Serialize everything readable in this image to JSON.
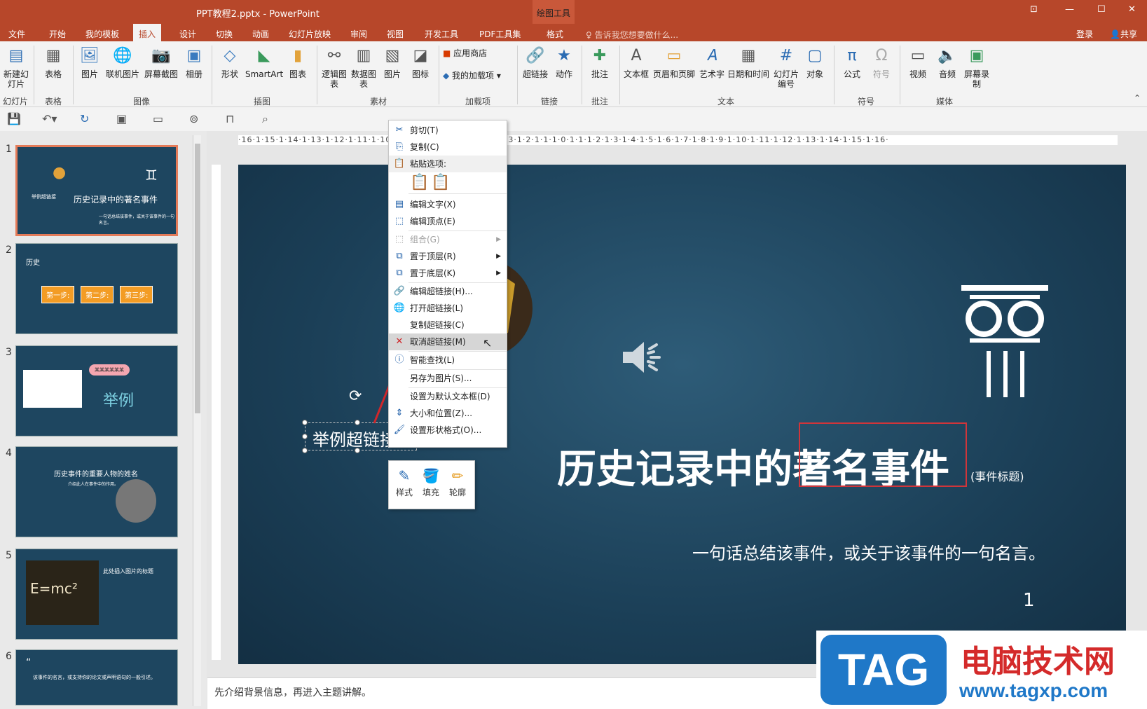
{
  "window": {
    "title": "PPT教程2.pptx - PowerPoint",
    "context_tab_group": "绘图工具"
  },
  "tabs": [
    "文件",
    "开始",
    "我的模板",
    "插入",
    "设计",
    "切换",
    "动画",
    "幻灯片放映",
    "审阅",
    "视图",
    "开发工具",
    "PDF工具集",
    "格式"
  ],
  "active_tab": "插入",
  "tell_me": "告诉我您想要做什么...",
  "account": {
    "login": "登录",
    "share": "共享"
  },
  "ribbon": {
    "buttons": [
      "新建幻灯片",
      "表格",
      "图片",
      "联机图片",
      "屏幕截图",
      "相册",
      "形状",
      "SmartArt",
      "图表",
      "逻辑图表",
      "数据图表",
      "图片",
      "图标",
      "应用商店",
      "我的加载项",
      "超链接",
      "动作",
      "批注",
      "文本框",
      "页眉和页脚",
      "艺术字",
      "日期和时间",
      "幻灯片编号",
      "对象",
      "公式",
      "符号",
      "视频",
      "音频",
      "屏幕录制"
    ],
    "groups": [
      "幻灯片",
      "表格",
      "图像",
      "插图",
      "素材",
      "加载项",
      "链接",
      "批注",
      "文本",
      "符号",
      "媒体"
    ]
  },
  "thumbnails": [
    {
      "num": "1",
      "title": "历史记录中的著名事件",
      "small": "举例超链接",
      "foot": "一句话总结该事件，或关于该事件的一句名言。"
    },
    {
      "num": "2",
      "title": "历史",
      "steps": [
        "第一步:",
        "第二步:",
        "第三步:"
      ]
    },
    {
      "num": "3",
      "title": "举例",
      "bubble": "某某某某某某"
    },
    {
      "num": "4",
      "title": "历史事件的重要人物的姓名",
      "sub": "介绍此人在事件中的作用。"
    },
    {
      "num": "5",
      "title": "此处插入图片的标题",
      "formula": "E=mc²"
    },
    {
      "num": "6",
      "title": "该事件的名言，或支持你的论文或声明语句的一般引述。"
    }
  ],
  "ruler": {
    "h_ticks": "·16·1·15·1·14·1·13·1·12·1·11·1·10·1·9·1·8·1·7·1·6·1·5·1·4·1·3·1·2·1·1·1·0·1·1·1·2·1·3·1·4·1·5·1·6·1·7·1·8·1·9·1·10·1·11·1·12·1·13·1·14·1·15·1·16·"
  },
  "slide": {
    "title": "历史记录中的著名事件",
    "title_hint": "(事件标题)",
    "quote": "一句话总结该事件，或关于该事件的一句名言。",
    "page_number": "1",
    "textbox": "举例超链接"
  },
  "context_menu": {
    "items": [
      {
        "label": "剪切(T)",
        "icon": "cut-icon"
      },
      {
        "label": "复制(C)",
        "icon": "copy-icon"
      },
      {
        "label": "粘贴选项:",
        "icon": "paste-icon"
      },
      {
        "label": "编辑文字(X)",
        "icon": "edit-text-icon"
      },
      {
        "label": "编辑顶点(E)",
        "icon": "edit-points-icon"
      },
      {
        "label": "组合(G)",
        "icon": "group-icon"
      },
      {
        "label": "置于顶层(R)",
        "icon": "bring-front-icon"
      },
      {
        "label": "置于底层(K)",
        "icon": "send-back-icon"
      },
      {
        "label": "编辑超链接(H)...",
        "icon": "edit-link-icon"
      },
      {
        "label": "打开超链接(L)",
        "icon": "open-link-icon"
      },
      {
        "label": "复制超链接(C)",
        "icon": ""
      },
      {
        "label": "取消超链接(M)",
        "icon": "remove-link-icon"
      },
      {
        "label": "智能查找(L)",
        "icon": "smart-lookup-icon"
      },
      {
        "label": "另存为图片(S)...",
        "icon": ""
      },
      {
        "label": "设置为默认文本框(D)",
        "icon": ""
      },
      {
        "label": "大小和位置(Z)...",
        "icon": "size-icon"
      },
      {
        "label": "设置形状格式(O)...",
        "icon": "format-shape-icon"
      }
    ]
  },
  "mini_toolbar": {
    "style": "样式",
    "fill": "填充",
    "outline": "轮廓"
  },
  "notes": "先介绍背景信息，再进入主题讲解。",
  "watermark": {
    "tag": "TAG",
    "cn": "电脑技术网",
    "url": "www.tagxp.com"
  },
  "colors": {
    "accent": "#b7472a",
    "slide_bg": "#1b3f57",
    "highlight": "#d0353a"
  }
}
